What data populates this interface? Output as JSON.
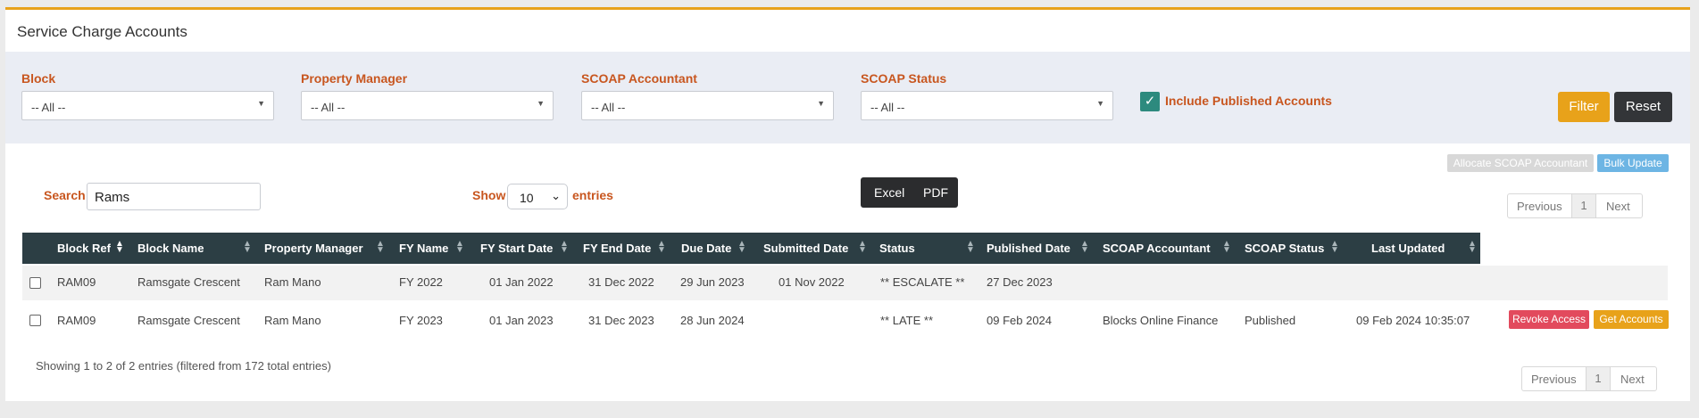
{
  "page": {
    "title": "Service Charge Accounts"
  },
  "filters": {
    "block": {
      "label": "Block",
      "value": "-- All --"
    },
    "property_manager": {
      "label": "Property Manager",
      "value": "-- All --"
    },
    "scoap_accountant": {
      "label": "SCOAP Accountant",
      "value": "-- All --"
    },
    "scoap_status": {
      "label": "SCOAP Status",
      "value": "-- All --"
    },
    "include_published": {
      "label": "Include Published Accounts",
      "checked": true
    },
    "filter_label": "Filter",
    "reset_label": "Reset"
  },
  "actions": {
    "allocate_label": "Allocate SCOAP Accountant",
    "bulk_update_label": "Bulk Update"
  },
  "table_controls": {
    "search_label": "Search:",
    "search_value": "Rams",
    "show_label": "Show",
    "page_size": "10",
    "entries_label": "entries",
    "excel_label": "Excel",
    "pdf_label": "PDF"
  },
  "pagination": {
    "previous": "Previous",
    "page": "1",
    "next": "Next"
  },
  "table": {
    "columns": [
      "Block Ref",
      "Block Name",
      "Property Manager",
      "FY Name",
      "FY Start Date",
      "FY End Date",
      "Due Date",
      "Submitted Date",
      "Status",
      "Published Date",
      "SCOAP Accountant",
      "SCOAP Status",
      "Last Updated"
    ],
    "rows": [
      {
        "block_ref": "RAM09",
        "block_name": "Ramsgate Crescent",
        "property_manager": "Ram Mano",
        "fy_name": "FY 2022",
        "fy_start": "01 Jan 2022",
        "fy_end": "31 Dec 2022",
        "due_date": "29 Jun 2023",
        "submitted_date": "01 Nov 2022",
        "status": "** ESCALATE **",
        "published_date": "27 Dec 2023",
        "scoap_accountant": "",
        "scoap_status": "",
        "last_updated": ""
      },
      {
        "block_ref": "RAM09",
        "block_name": "Ramsgate Crescent",
        "property_manager": "Ram Mano",
        "fy_name": "FY 2023",
        "fy_start": "01 Jan 2023",
        "fy_end": "31 Dec 2023",
        "due_date": "28 Jun 2024",
        "submitted_date": "",
        "status": "** LATE **",
        "published_date": "09 Feb 2024",
        "scoap_accountant": "Blocks Online Finance",
        "scoap_status": "Published",
        "last_updated": "09 Feb 2024 10:35:07",
        "revoke_label": "Revoke Access",
        "get_label": "Get Accounts"
      }
    ]
  },
  "info": "Showing 1 to 2 of 2 entries (filtered from 172 total entries)",
  "icons": {
    "caret": "caret-down-icon",
    "sort": "sort-icon",
    "check": "check-icon"
  },
  "colors": {
    "accent": "#e8a21a",
    "label": "#c8561f",
    "header": "#2c3e44",
    "danger": "#e24a5d",
    "info": "#6db5e4"
  }
}
